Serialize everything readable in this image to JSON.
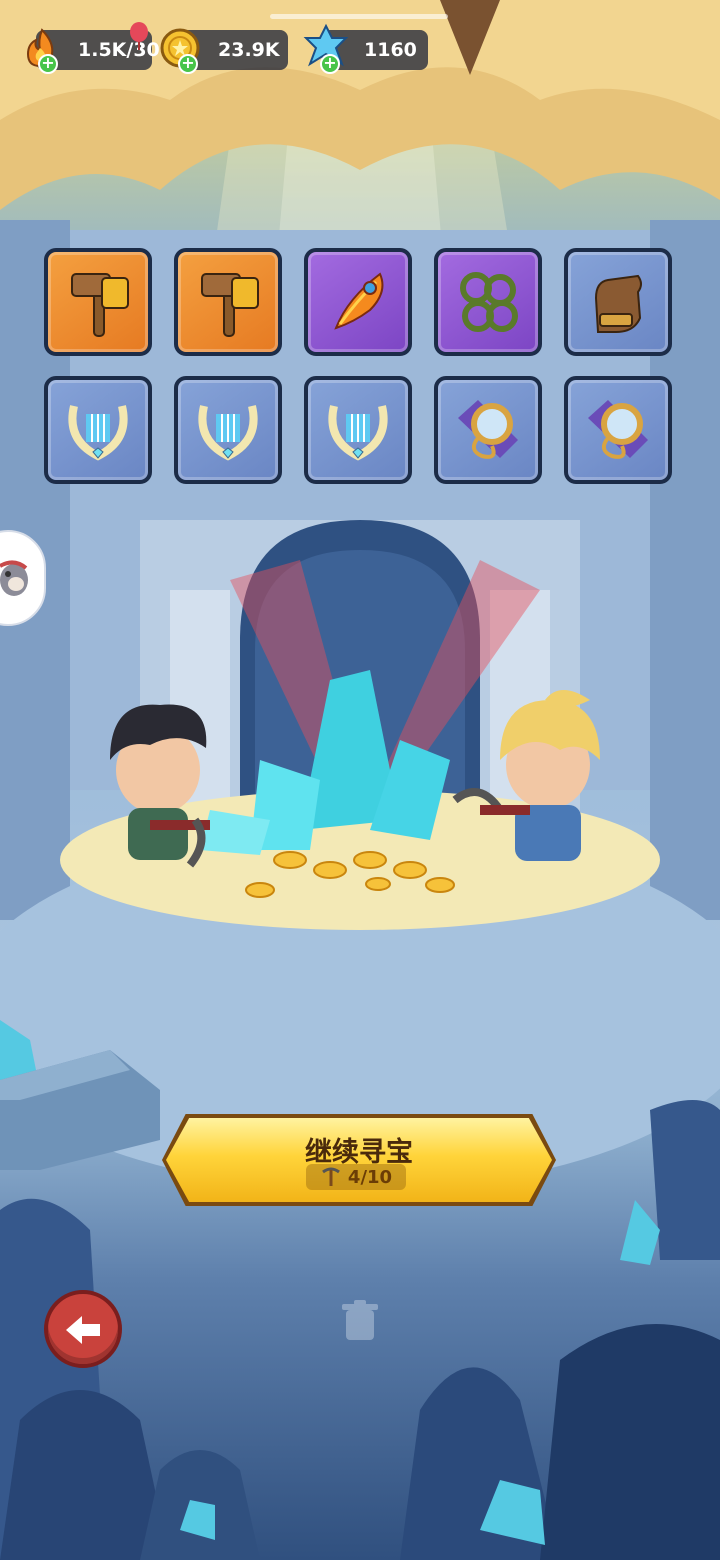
{
  "resources": {
    "energy": {
      "icon": "flame-icon",
      "value": "1.5K/30"
    },
    "coins": {
      "icon": "coin-icon",
      "value": "23.9K"
    },
    "crystals": {
      "icon": "crystal-icon",
      "value": "1160"
    }
  },
  "items": [
    {
      "icon": "hammer-icon",
      "rarity": "orange"
    },
    {
      "icon": "hammer-icon",
      "rarity": "orange"
    },
    {
      "icon": "feather-icon",
      "rarity": "purple"
    },
    {
      "icon": "thorn-vine-icon",
      "rarity": "purple"
    },
    {
      "icon": "glove-icon",
      "rarity": "blue"
    },
    {
      "icon": "lyre-icon",
      "rarity": "blue"
    },
    {
      "icon": "lyre-icon",
      "rarity": "blue"
    },
    {
      "icon": "lyre-icon",
      "rarity": "blue"
    },
    {
      "icon": "magnifier-icon",
      "rarity": "blue"
    },
    {
      "icon": "magnifier-icon",
      "rarity": "blue"
    }
  ],
  "main_button": {
    "label": "继续寻宝",
    "icon": "pickaxe-icon",
    "progress": "4/10"
  },
  "colors": {
    "orange_slot": "#f4a040",
    "purple_slot": "#a36be0",
    "blue_slot": "#86a3d8",
    "button_gold": "#ffd43a",
    "back_red": "#c9423c"
  }
}
